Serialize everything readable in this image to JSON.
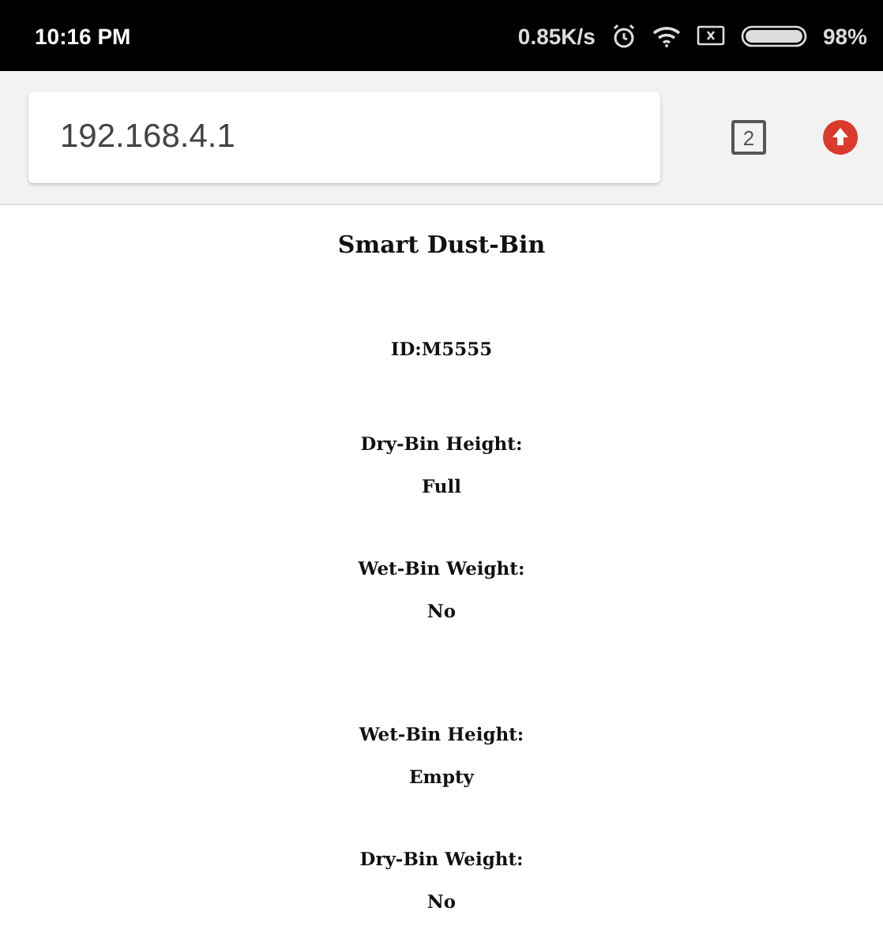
{
  "status_bar": {
    "time": "10:16 PM",
    "speed": "0.85K/s",
    "battery": "98%"
  },
  "browser": {
    "url": "192.168.4.1",
    "tab_count": "2"
  },
  "page": {
    "title": "Smart Dust-Bin",
    "id": "ID:M5555",
    "fields": [
      {
        "label": "Dry-Bin Height:",
        "value": "Full"
      },
      {
        "label": "Wet-Bin Weight:",
        "value": "No"
      },
      {
        "label": "Wet-Bin Height:",
        "value": "Empty"
      },
      {
        "label": "Dry-Bin Weight:",
        "value": "No"
      }
    ]
  }
}
